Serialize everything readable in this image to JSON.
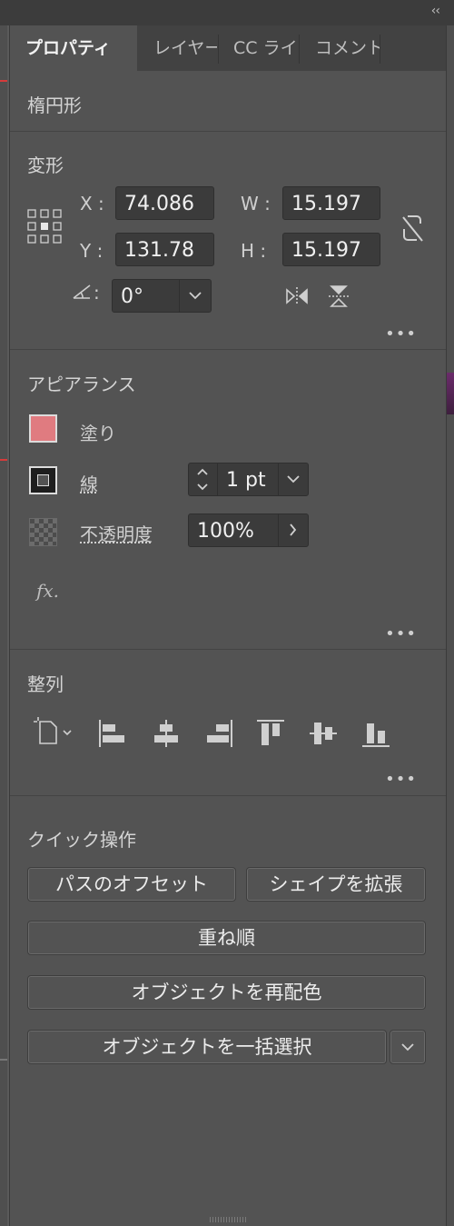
{
  "panel": {
    "collapse_label": "‹‹"
  },
  "tabs": [
    {
      "label": "プロパティ"
    },
    {
      "label": "レイヤー"
    },
    {
      "label": "CC ライ"
    },
    {
      "label": "コメント"
    }
  ],
  "object_type": "楕円形",
  "transform": {
    "title": "変形",
    "x_label": "X :",
    "x_value": "74.086",
    "y_label": "Y :",
    "y_value": "131.78",
    "w_label": "W :",
    "w_value": "15.197",
    "h_label": "H :",
    "h_value": "15.197",
    "angle_label": ":",
    "angle_value": "0°"
  },
  "appearance": {
    "title": "アピアランス",
    "fill_label": "塗り",
    "fill_color": "#e07b80",
    "stroke_label": "線",
    "stroke_value": "1 pt",
    "opacity_label": "不透明度",
    "opacity_value": "100%",
    "fx_label": "fx."
  },
  "align": {
    "title": "整列"
  },
  "quick_actions": {
    "title": "クイック操作",
    "offset_path": "パスのオフセット",
    "expand_shape": "シェイプを拡張",
    "arrange": "重ね順",
    "recolor": "オブジェクトを再配色",
    "select_same": "オブジェクトを一括選択"
  },
  "more_label": "•••"
}
